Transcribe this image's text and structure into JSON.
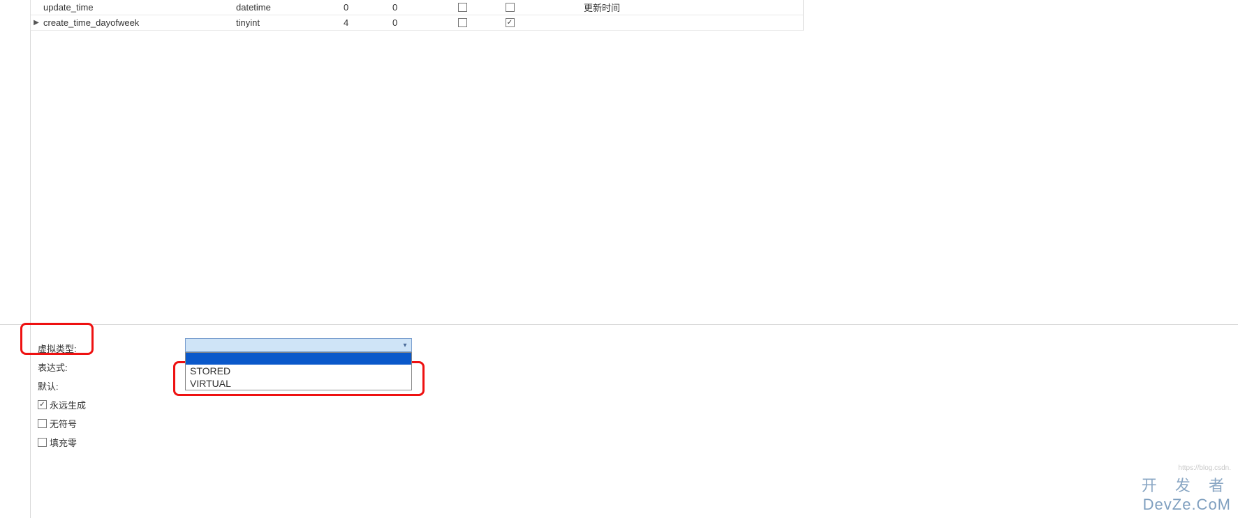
{
  "grid": {
    "rows": [
      {
        "selected": false,
        "name": "update_time",
        "type": "datetime",
        "length": "0",
        "decimals": "0",
        "notnull": false,
        "virtual": false,
        "comment": "更新时间"
      },
      {
        "selected": true,
        "name": "create_time_dayofweek",
        "type": "tinyint",
        "length": "4",
        "decimals": "0",
        "notnull": false,
        "virtual": true,
        "comment": ""
      }
    ]
  },
  "props": {
    "virtual_type_label": "虚拟类型:",
    "expression_label": "表达式:",
    "default_label": "默认:",
    "always_generate_label": "永远生成",
    "always_generate_checked": true,
    "unsigned_label": "无符号",
    "unsigned_checked": false,
    "zerofill_label": "填充零",
    "zerofill_checked": false
  },
  "combo": {
    "value": "",
    "options_top_selected": "",
    "option1": "STORED",
    "option2": "VIRTUAL"
  },
  "watermark": {
    "tiny": "https://blog.csdn.",
    "line1": "开 发 者",
    "line2": "DevZe.CoM"
  }
}
